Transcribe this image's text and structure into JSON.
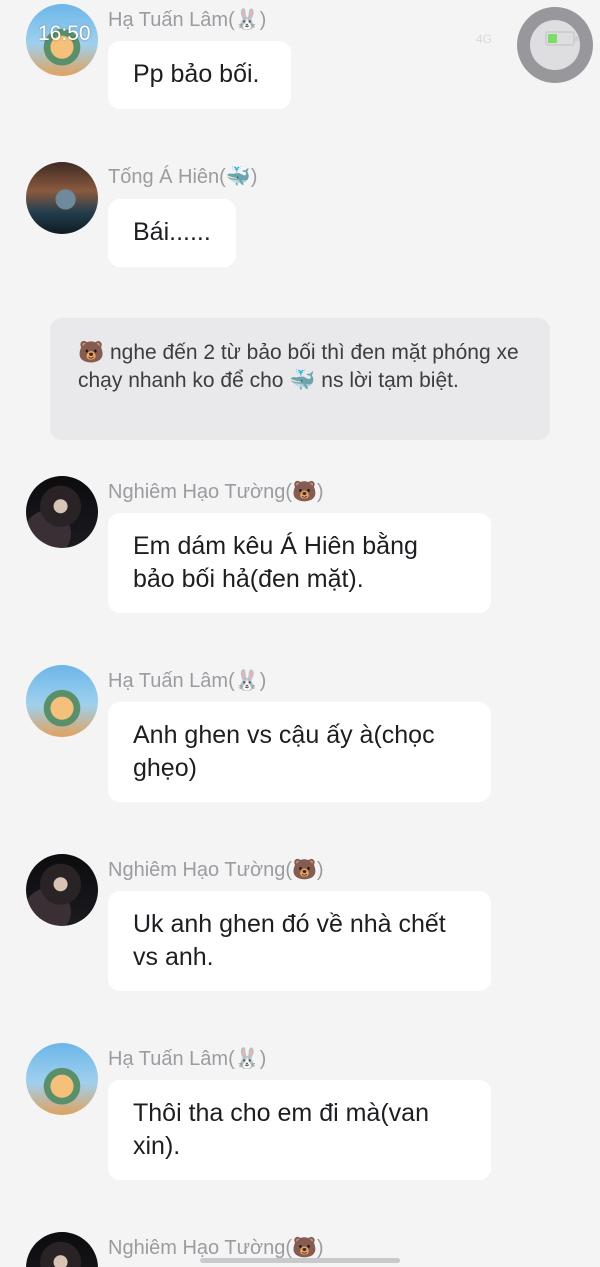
{
  "status_bar": {
    "time": "16:50",
    "signal": "4G"
  },
  "messages": [
    {
      "sender": "Hạ Tuấn Lâm(🐰)",
      "text": "Pp bảo bối."
    },
    {
      "sender": "Tống Á Hiên(🐳)",
      "text": "Bái......"
    },
    {
      "narration": "🐻 nghe đến 2 từ bảo bối thì đen mặt phóng xe chạy nhanh ko để cho 🐳 ns lời tạm biệt."
    },
    {
      "sender": "Nghiêm Hạo Tường(🐻)",
      "text": "Em dám kêu Á Hiên bằng\nbảo bối hả(đen mặt)."
    },
    {
      "sender": "Hạ Tuấn Lâm(🐰)",
      "text": "Anh ghen vs cậu ấy à(chọc\nghẹo)"
    },
    {
      "sender": "Nghiêm Hạo Tường(🐻)",
      "text": "Uk anh ghen đó về nhà chết\nvs anh."
    },
    {
      "sender": "Hạ Tuấn Lâm(🐰)",
      "text": "Thôi tha cho em đi mà(van\nxin)."
    },
    {
      "sender": "Nghiêm Hạo Tường(🐻)"
    }
  ]
}
